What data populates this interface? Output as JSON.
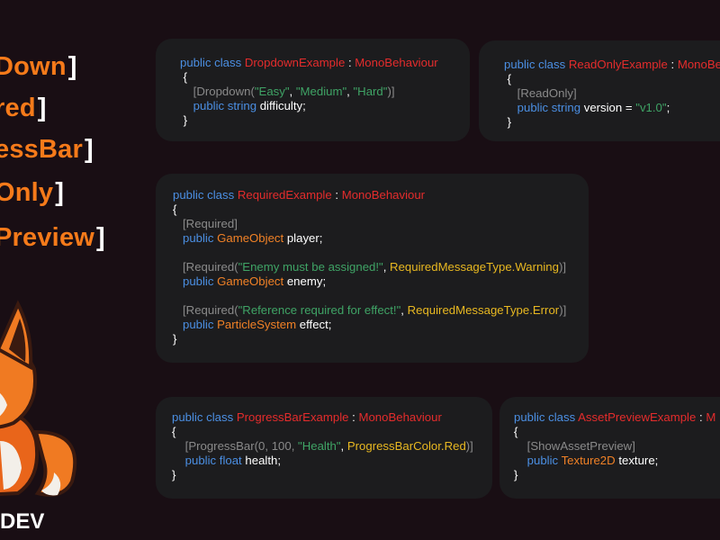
{
  "attributes": [
    "Down",
    "red",
    "essBar",
    "Only",
    "Preview"
  ],
  "brand": "DEV",
  "cards": {
    "dropdown": {
      "class_name": "DropdownExample",
      "attr_name": "Dropdown",
      "options": [
        "\"Easy\"",
        "\"Medium\"",
        "\"Hard\""
      ],
      "field_type": "string",
      "field_name": "difficulty"
    },
    "readonly": {
      "class_name": "ReadOnlyExample",
      "attr_name": "ReadOnly",
      "field_type": "string",
      "field_name": "version",
      "value": "\"v1.0\""
    },
    "required": {
      "class_name": "RequiredExample",
      "attr_name": "Required",
      "field1_type": "GameObject",
      "field1_name": "player",
      "msg2": "\"Enemy must be assigned!\"",
      "enum2": "RequiredMessageType.Warning",
      "field2_type": "GameObject",
      "field2_name": "enemy",
      "msg3": "\"Reference required for effect!\"",
      "enum3": "RequiredMessageType.Error",
      "field3_type": "ParticleSystem",
      "field3_name": "effect"
    },
    "progress": {
      "class_name": "ProgressBarExample",
      "attr_name": "ProgressBar",
      "args": "0, 100, ",
      "label": "\"Health\"",
      "color_enum": "ProgressBarColor.Red",
      "field_type": "float",
      "field_name": "health"
    },
    "asset": {
      "class_name": "AssetPreviewExample",
      "class_after": ": M",
      "attr_name": "ShowAssetPreview",
      "field_type": "Texture2D",
      "field_name": "texture"
    }
  },
  "syntax": {
    "kw_public": "public",
    "kw_class": "class",
    "base_class": "MonoBehaviour",
    "base_trunc_readonly": "MonoBe",
    "open_brace": "{",
    "close_brace": "}"
  },
  "colors": {
    "background": "#190e14",
    "card": "#1c1c1e",
    "keyword": "#4b8fe3",
    "class": "#e42c2c",
    "type": "#f08126",
    "string": "#3fa365",
    "bracket": "#8a8a8a",
    "enum": "#e8b821",
    "accent": "#f57a1a"
  }
}
